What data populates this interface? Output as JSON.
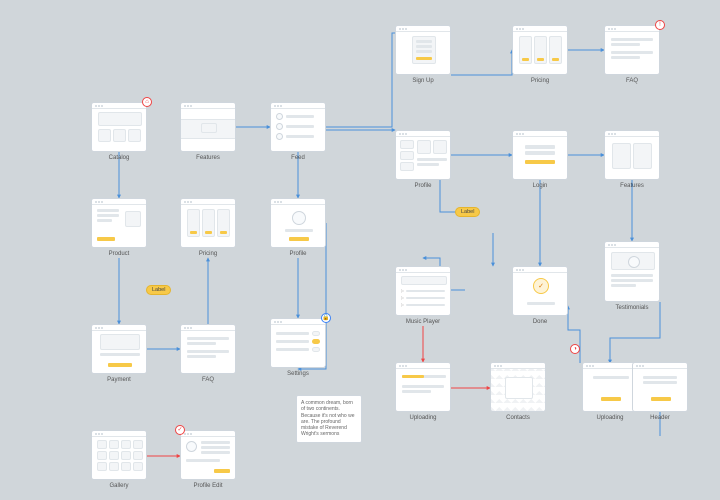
{
  "nodes": {
    "catalog": {
      "label": "Catalog"
    },
    "features": {
      "label": "Features"
    },
    "feed": {
      "label": "Feed"
    },
    "signup": {
      "label": "Sign Up"
    },
    "pricing_t": {
      "label": "Pricing"
    },
    "faq_t": {
      "label": "FAQ"
    },
    "product": {
      "label": "Product"
    },
    "pricing_b": {
      "label": "Pricing"
    },
    "profile": {
      "label": "Profile"
    },
    "profile2": {
      "label": "Profile"
    },
    "login": {
      "label": "Login"
    },
    "features2": {
      "label": "Features"
    },
    "payment": {
      "label": "Payment"
    },
    "faq_b": {
      "label": "FAQ"
    },
    "settings": {
      "label": "Settings"
    },
    "music": {
      "label": "Music Player"
    },
    "done": {
      "label": "Done"
    },
    "testimonials": {
      "label": "Testimonials"
    },
    "gallery": {
      "label": "Gallery"
    },
    "profileedit": {
      "label": "Profile Edit"
    },
    "uploading": {
      "label": "Uploading"
    },
    "contacts": {
      "label": "Contacts"
    },
    "header": {
      "label": "Header"
    }
  },
  "edge_labels": {
    "label1": "Label",
    "label2": "Label"
  },
  "note_text": "A common dream, born of two continents. Because it's not who we are. The profound mistake of Reverend Wright's sermons",
  "badges": {
    "catalog": "⌂",
    "faq_t": "!",
    "settings": "🔒",
    "profileedit": "✓",
    "contacts_area": "◑"
  }
}
